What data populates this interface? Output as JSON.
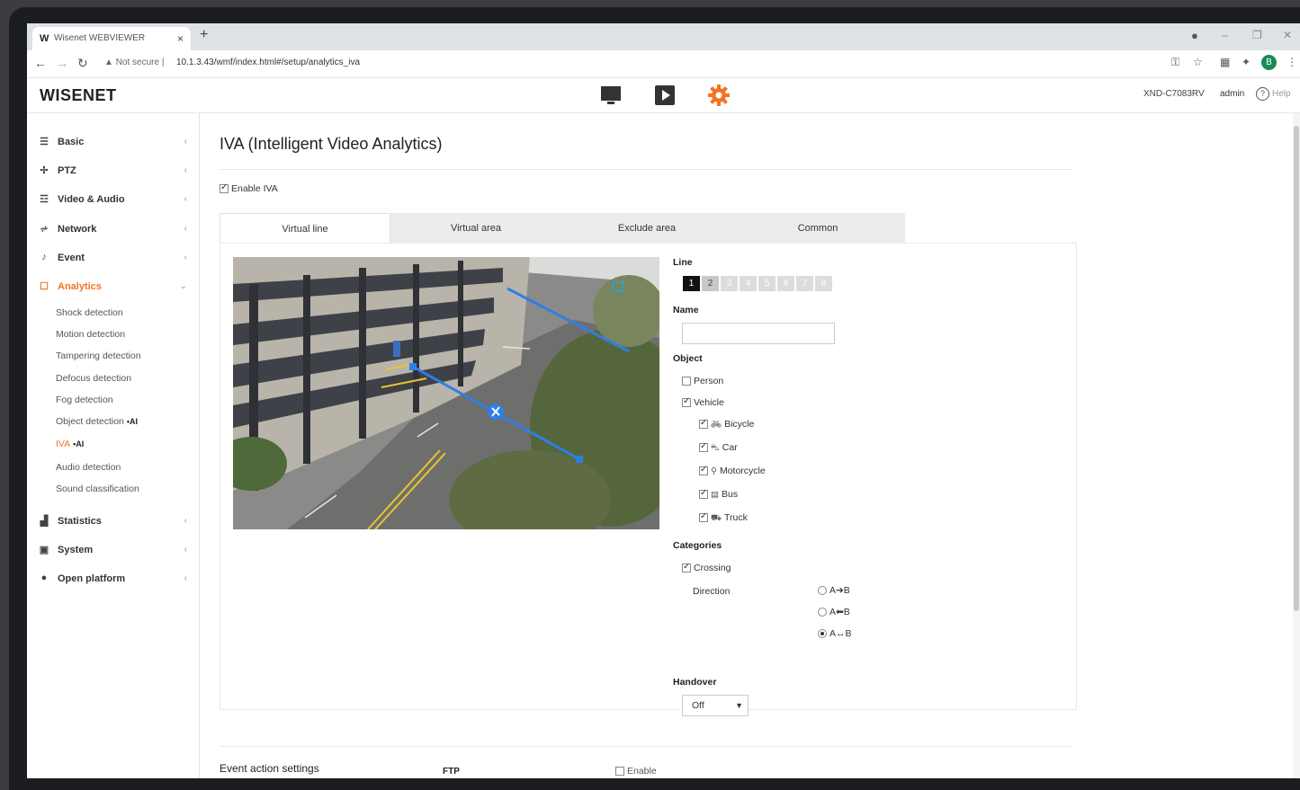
{
  "browser": {
    "tab_favicon": "W",
    "tab_title": "Wisenet WEBVIEWER",
    "tab_close": "×",
    "new_tab": "+",
    "not_secure": "Not secure",
    "url": "10.1.3.43/wmf/index.html#/setup/analytics_iva",
    "profile_initial": "B"
  },
  "header": {
    "logo": "WISENET",
    "model": "XND-C7083RV",
    "user": "admin",
    "help": "Help",
    "accent_color": "#f37321"
  },
  "sidebar": {
    "items": [
      {
        "label": "Basic",
        "icon": "list-icon"
      },
      {
        "label": "PTZ",
        "icon": "move-icon"
      },
      {
        "label": "Video & Audio",
        "icon": "sliders-icon"
      },
      {
        "label": "Network",
        "icon": "network-icon"
      },
      {
        "label": "Event",
        "icon": "bell-icon"
      },
      {
        "label": "Analytics",
        "icon": "analytics-icon"
      },
      {
        "label": "Statistics",
        "icon": "bar-chart-icon"
      },
      {
        "label": "System",
        "icon": "system-icon"
      },
      {
        "label": "Open platform",
        "icon": "platform-icon"
      }
    ],
    "analytics_sub": [
      {
        "label": "Shock detection",
        "ai": ""
      },
      {
        "label": "Motion detection",
        "ai": ""
      },
      {
        "label": "Tampering detection",
        "ai": ""
      },
      {
        "label": "Defocus detection",
        "ai": ""
      },
      {
        "label": "Fog detection",
        "ai": ""
      },
      {
        "label": "Object detection",
        "ai": "•AI"
      },
      {
        "label": "IVA",
        "ai": "•AI"
      },
      {
        "label": "Audio detection",
        "ai": ""
      },
      {
        "label": "Sound classification",
        "ai": ""
      }
    ]
  },
  "main": {
    "title": "IVA (Intelligent Video Analytics)",
    "enable_iva": "Enable IVA",
    "tabs": [
      "Virtual line",
      "Virtual area",
      "Exclude area",
      "Common"
    ],
    "line_label": "Line",
    "line_numbers": [
      "1",
      "2",
      "3",
      "4",
      "5",
      "6",
      "7",
      "8"
    ],
    "name_label": "Name",
    "object_label": "Object",
    "person": "Person",
    "vehicle": "Vehicle",
    "vehicle_types": [
      "Bicycle",
      "Car",
      "Motorcycle",
      "Bus",
      "Truck"
    ],
    "categories_label": "Categories",
    "crossing": "Crossing",
    "direction_label": "Direction",
    "directions": [
      "A➔B",
      "A⬅B",
      "A↔B"
    ],
    "handover_label": "Handover",
    "handover_value": "Off",
    "event_action": "Event action settings",
    "ftp": "FTP",
    "ftp_enable": "Enable"
  }
}
